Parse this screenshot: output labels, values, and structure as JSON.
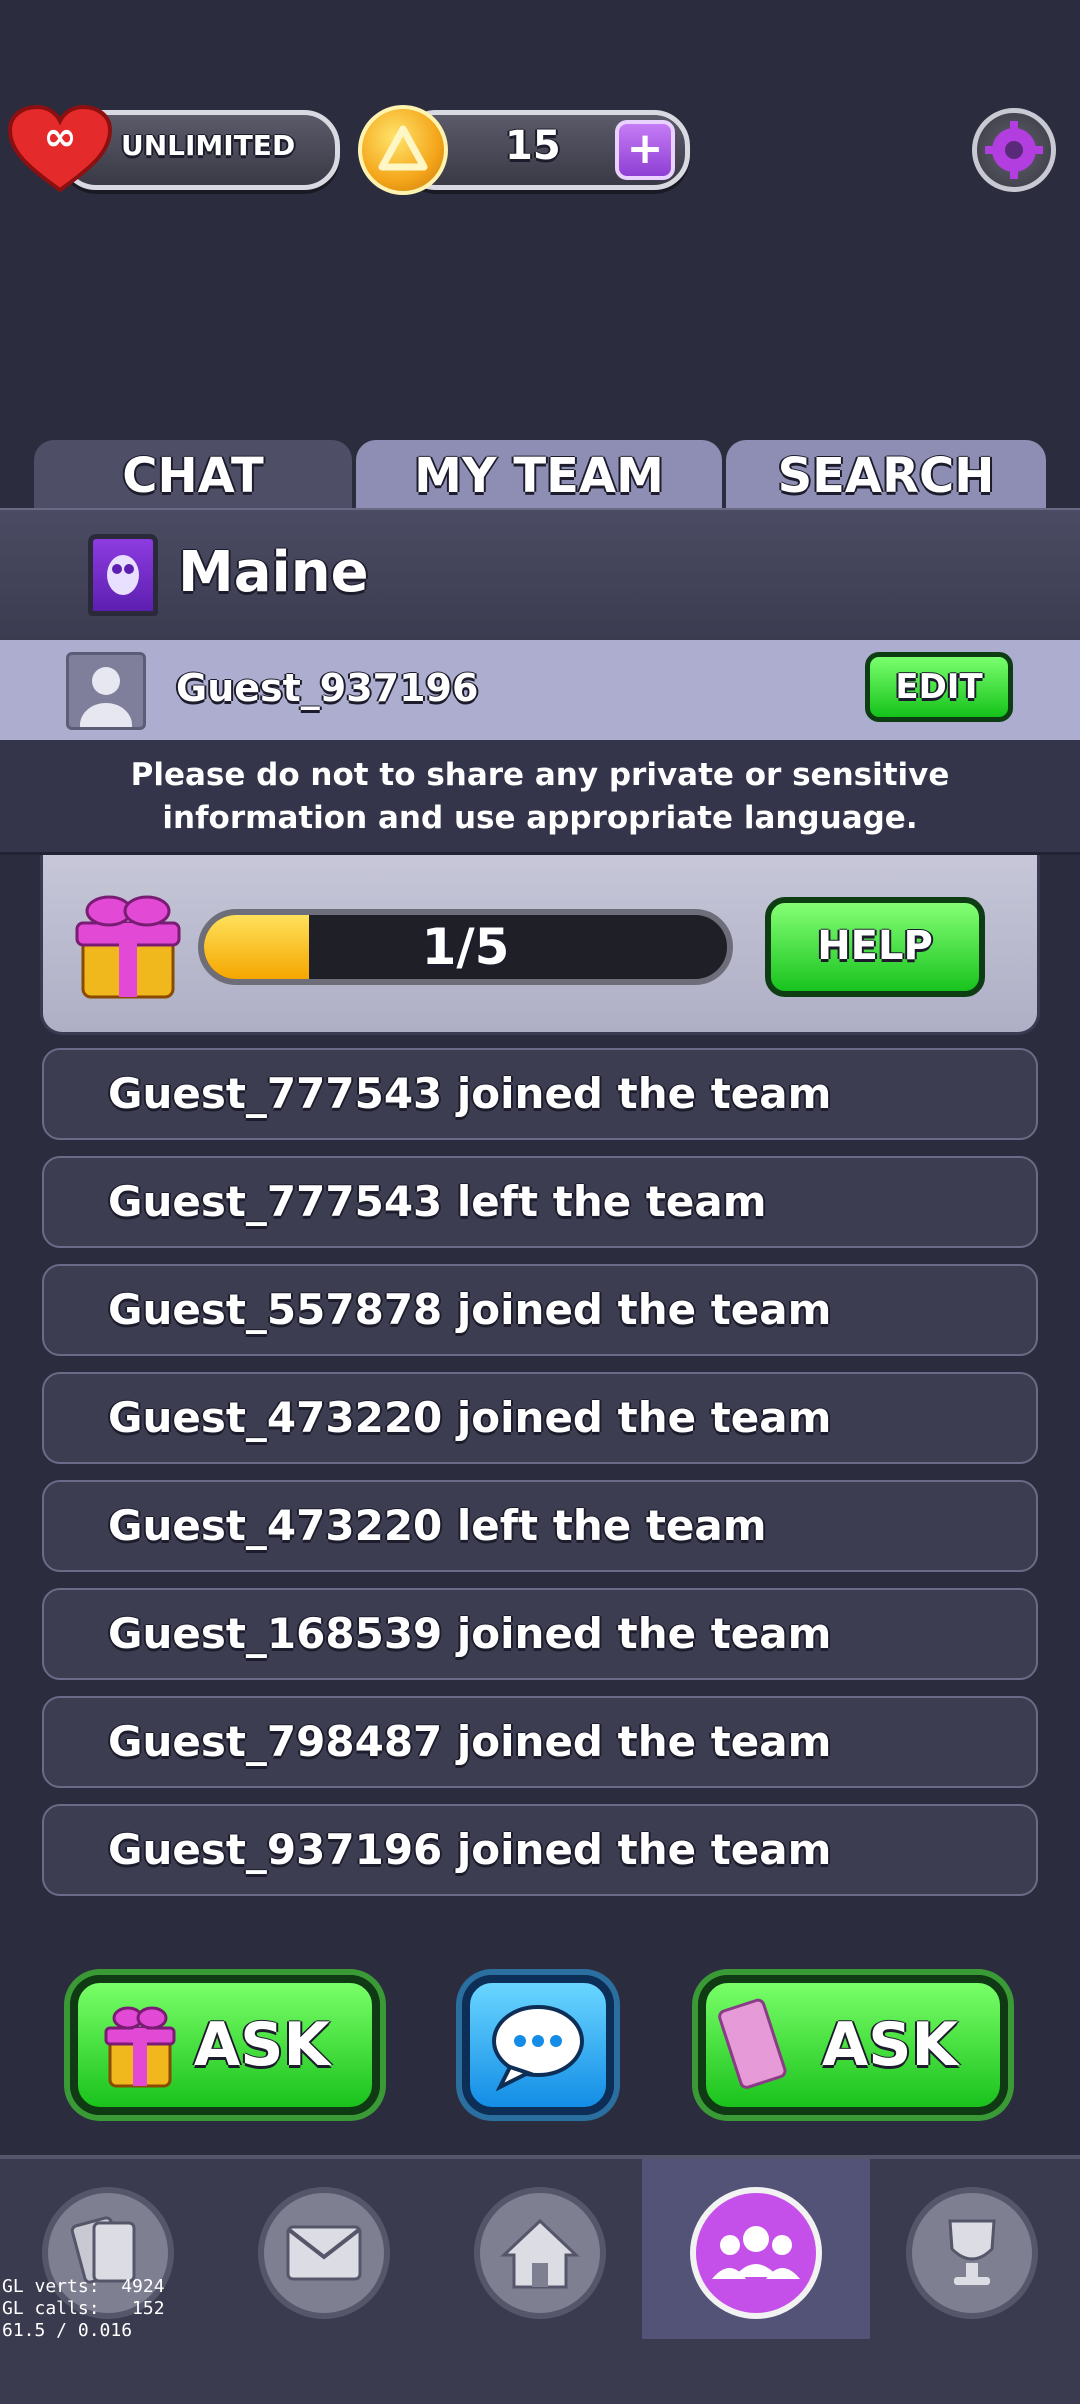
{
  "top_bar": {
    "lives_label": "UNLIMITED",
    "coins_value": "15",
    "plus_symbol": "+"
  },
  "tabs": [
    {
      "label": "CHAT",
      "active": true
    },
    {
      "label": "MY TEAM",
      "active": false
    },
    {
      "label": "SEARCH",
      "active": false
    }
  ],
  "team": {
    "name": "Maine",
    "badge_icon": "owl-badge-icon"
  },
  "user": {
    "name": "Guest_937196",
    "edit_label": "EDIT"
  },
  "notice": {
    "line1": "Please do not to share any private or sensitive",
    "line2": "information and use appropriate language."
  },
  "request_card": {
    "progress": 0.2,
    "progress_text": "1/5",
    "help_label": "HELP"
  },
  "messages": [
    "Guest_777543 joined the team",
    "Guest_777543 left the team",
    "Guest_557878 joined the team",
    "Guest_473220 joined the team",
    "Guest_473220 left the team",
    "Guest_168539 joined the team",
    "Guest_798487 joined the team",
    "Guest_937196 joined the team"
  ],
  "actions": {
    "ask_lives_label": "ASK",
    "ask_cards_label": "ASK"
  },
  "bottom_nav": [
    {
      "name": "cards-icon"
    },
    {
      "name": "mail-icon"
    },
    {
      "name": "home-icon"
    },
    {
      "name": "team-icon",
      "active": true
    },
    {
      "name": "trophy-icon"
    }
  ],
  "debug": {
    "line1": "GL verts:  4924",
    "line2": "GL calls:   152",
    "line3": "61.5 / 0.016"
  },
  "colors": {
    "background": "#2c2c3f",
    "accent_green": "#1ac21c",
    "accent_purple": "#c54fe9"
  }
}
